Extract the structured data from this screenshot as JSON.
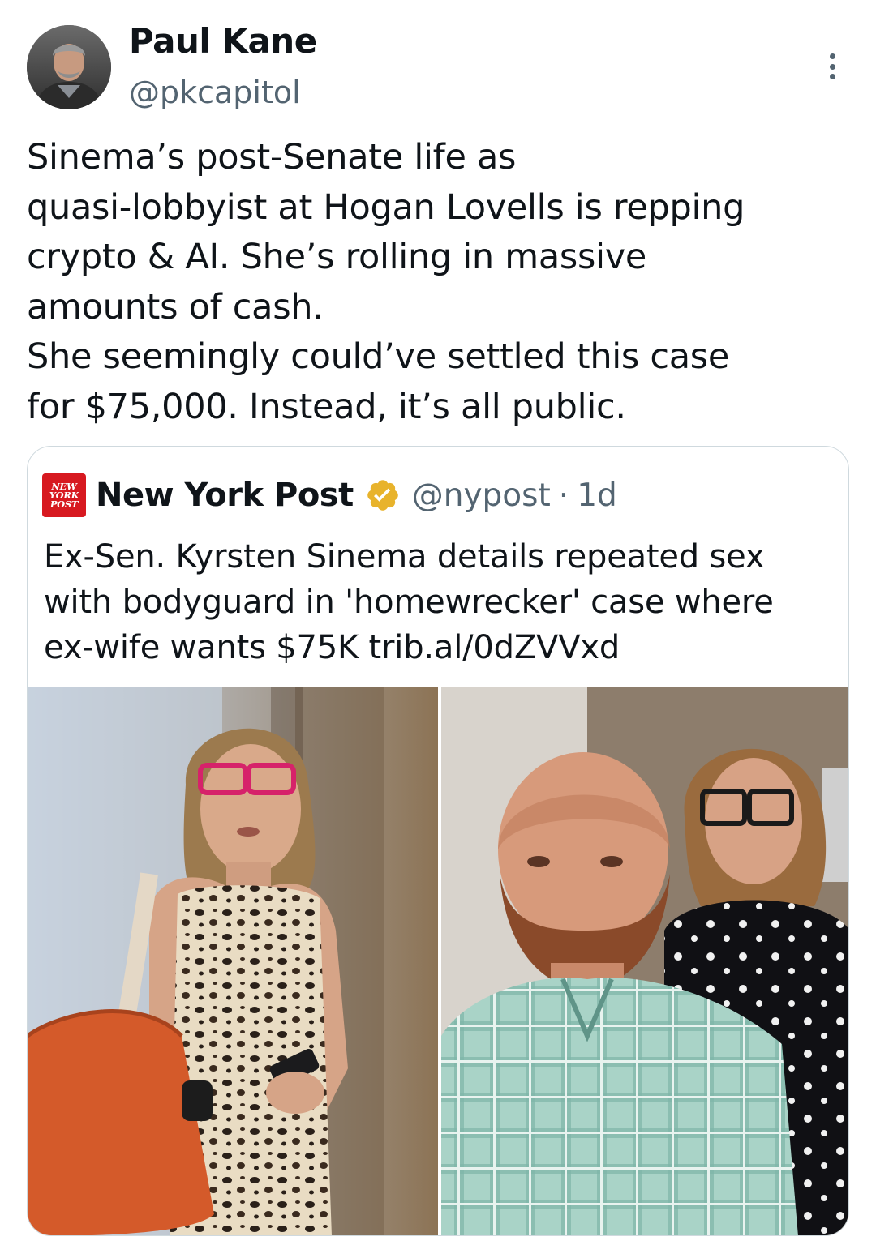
{
  "tweet": {
    "display_name": "Paul Kane",
    "handle": "@pkcapitol",
    "text_lines": [
      "Sinema’s post-Senate life as",
      "quasi-lobbyist at Hogan Lovells is repping",
      "crypto & AI. She’s rolling in massive",
      "amounts of cash.",
      "She seemingly could’ve settled this case",
      "for $75,000. Instead, it’s all public."
    ]
  },
  "quote": {
    "logo_lines": [
      "NEW",
      "YORK",
      "POST"
    ],
    "name": "New York Post",
    "handle": "@nypost",
    "separator": "·",
    "age": "1d",
    "text_lines": [
      "Ex-Sen. Kyrsten Sinema details repeated sex",
      "with bodyguard in 'homewrecker' case where",
      "ex-wife wants $75K trib.al/0dZVVxd"
    ]
  },
  "colors": {
    "text_primary": "#0f1419",
    "text_secondary": "#536471",
    "border": "#cfd9de",
    "verified_gold": "#e8b32c",
    "nyp_red": "#d71920"
  },
  "icons": {
    "more": "more-vertical-icon",
    "verified": "verified-badge-icon",
    "logo": "new-york-post-logo"
  }
}
